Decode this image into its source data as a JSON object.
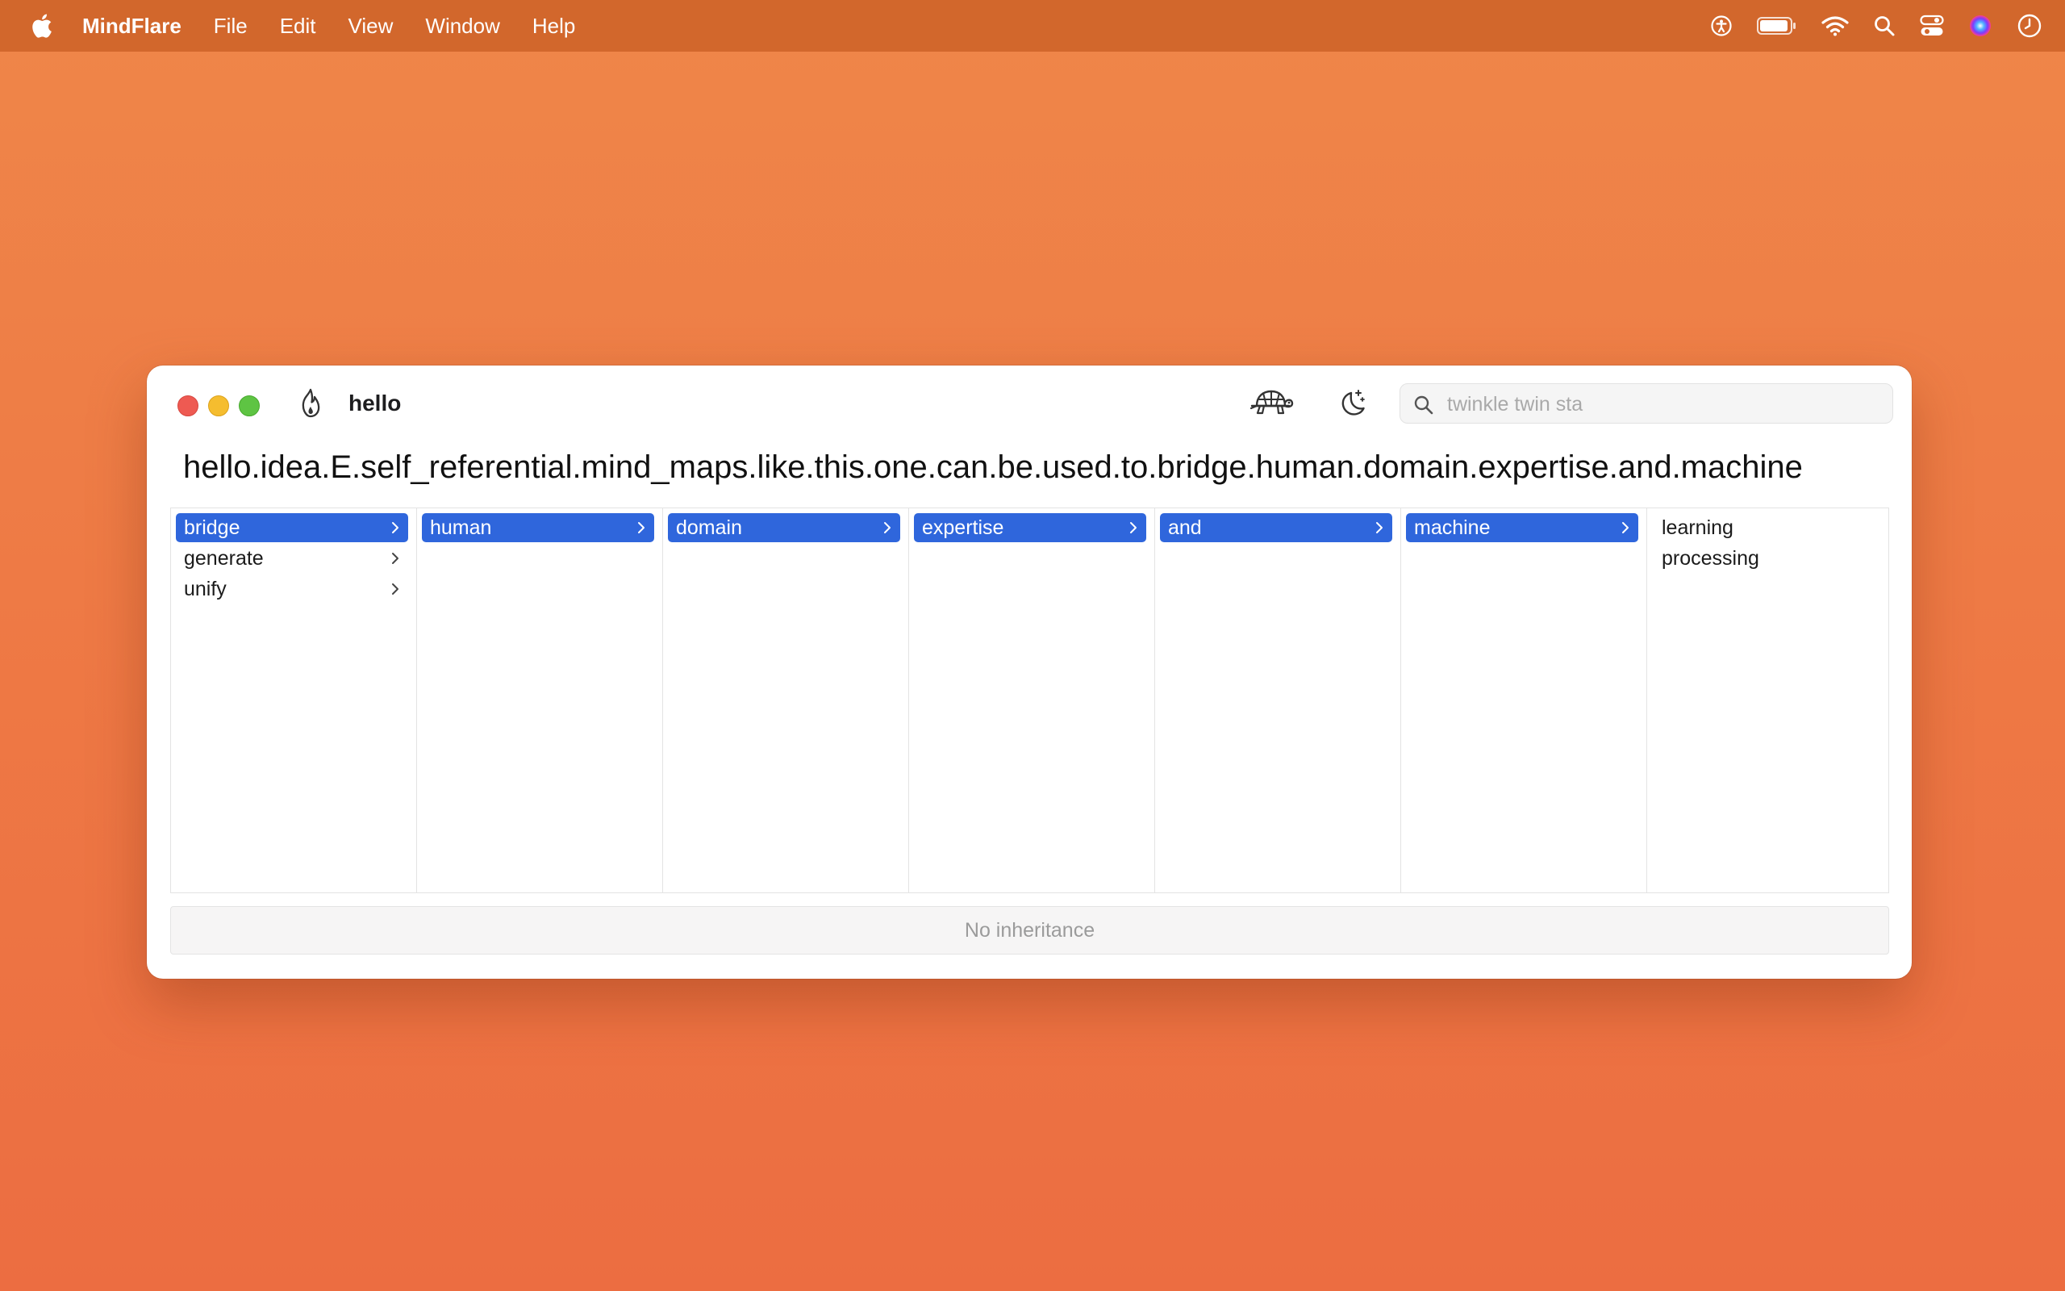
{
  "menubar": {
    "app_name": "MindFlare",
    "items": [
      "File",
      "Edit",
      "View",
      "Window",
      "Help"
    ],
    "status_icons": [
      "accessibility-icon",
      "battery-icon",
      "wifi-icon",
      "search-icon",
      "control-center-icon",
      "siri-icon",
      "clock-icon"
    ]
  },
  "window": {
    "title": "hello",
    "search": {
      "placeholder": "twinkle twin sta",
      "value": ""
    },
    "path": "hello.idea.E.self_referential.mind_maps.like.this.one.can.be.used.to.bridge.human.domain.expertise.and.machine",
    "columns": [
      {
        "items": [
          {
            "label": "bridge",
            "selected": true,
            "has_children": true
          },
          {
            "label": "generate",
            "selected": false,
            "has_children": true
          },
          {
            "label": "unify",
            "selected": false,
            "has_children": true
          }
        ]
      },
      {
        "items": [
          {
            "label": "human",
            "selected": true,
            "has_children": true
          }
        ]
      },
      {
        "items": [
          {
            "label": "domain",
            "selected": true,
            "has_children": true
          }
        ]
      },
      {
        "items": [
          {
            "label": "expertise",
            "selected": true,
            "has_children": true
          }
        ]
      },
      {
        "items": [
          {
            "label": "and",
            "selected": true,
            "has_children": true
          }
        ]
      },
      {
        "items": [
          {
            "label": "machine",
            "selected": true,
            "has_children": true
          }
        ]
      },
      {
        "items": [
          {
            "label": "learning",
            "selected": false,
            "has_children": false
          },
          {
            "label": "processing",
            "selected": false,
            "has_children": false
          }
        ]
      }
    ],
    "status": "No inheritance"
  },
  "colors": {
    "selection": "#2f66dc",
    "menubar": "#d2672c",
    "desktop": "#ee7a45"
  }
}
